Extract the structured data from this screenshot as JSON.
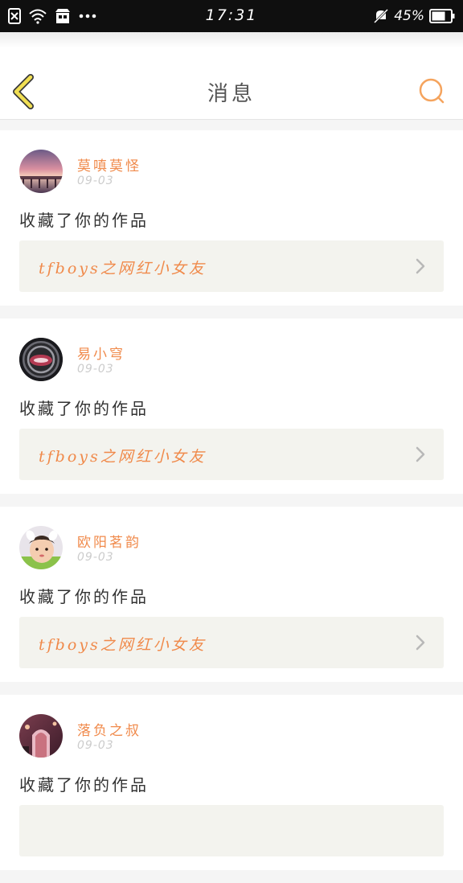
{
  "status_bar": {
    "time": "17:31",
    "battery": "45%",
    "icons": [
      "sim-error-icon",
      "wifi-icon",
      "store-icon",
      "more-dots-icon",
      "mute-icon",
      "battery-icon"
    ]
  },
  "header": {
    "title": "消息",
    "back_icon": "chevron-left-icon",
    "search_icon": "search-icon"
  },
  "accent_color": "#f08a4b",
  "messages": [
    {
      "user": "莫嗔莫怪",
      "date": "09-03",
      "action": "收藏了你的作品",
      "work_title": "tfboys之网红小女友"
    },
    {
      "user": "易小穹",
      "date": "09-03",
      "action": "收藏了你的作品",
      "work_title": "tfboys之网红小女友"
    },
    {
      "user": "欧阳茗韵",
      "date": "09-03",
      "action": "收藏了你的作品",
      "work_title": "tfboys之网红小女友"
    },
    {
      "user": "落负之叔",
      "date": "09-03",
      "action": "收藏了你的作品",
      "work_title": ""
    }
  ]
}
